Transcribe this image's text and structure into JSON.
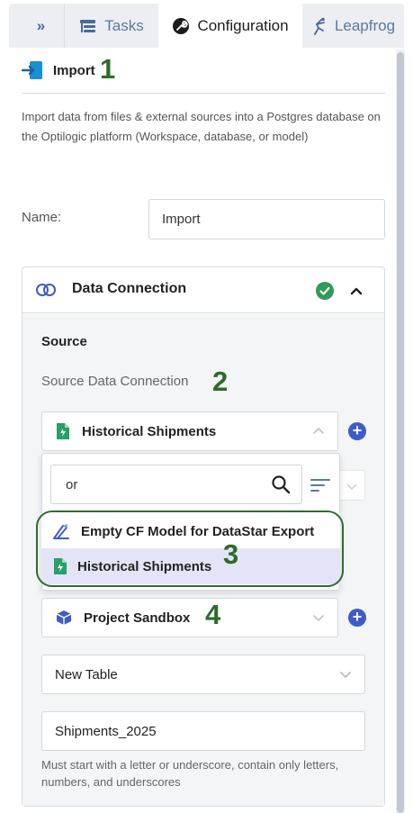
{
  "tabs": {
    "collapse": "»",
    "items": [
      {
        "label": "Tasks",
        "icon": "tasks-icon"
      },
      {
        "label": "Configuration",
        "icon": "wrench-icon",
        "active": true
      },
      {
        "label": "Leapfrog",
        "icon": "leapfrog-icon"
      }
    ]
  },
  "header": {
    "title": "Import",
    "step": "1",
    "description": "Import data from files & external sources into a Postgres database on the Optilogic platform (Workspace, database, or model)"
  },
  "name_field": {
    "label": "Name:",
    "value": "Import"
  },
  "data_connection": {
    "title": "Data Connection",
    "status": "valid",
    "source_label": "Source",
    "source_connection_label": "Source Data Connection",
    "step": "2",
    "selected": "Historical Shipments",
    "search_value": "or",
    "options": [
      "Empty CF Model for DataStar Export",
      "Historical Shipments"
    ],
    "options_step": "3",
    "destination": {
      "connection": "Project Sandbox",
      "step": "4",
      "table_mode": "New Table",
      "table_name": "Shipments_2025"
    },
    "hint": "Must start with a letter or underscore, contain only letters, numbers, and underscores"
  },
  "colors": {
    "accent": "#3f5bc9",
    "success": "#2e9b57",
    "annotation": "#2e6b2a",
    "highlight": "#e3e5f7"
  }
}
